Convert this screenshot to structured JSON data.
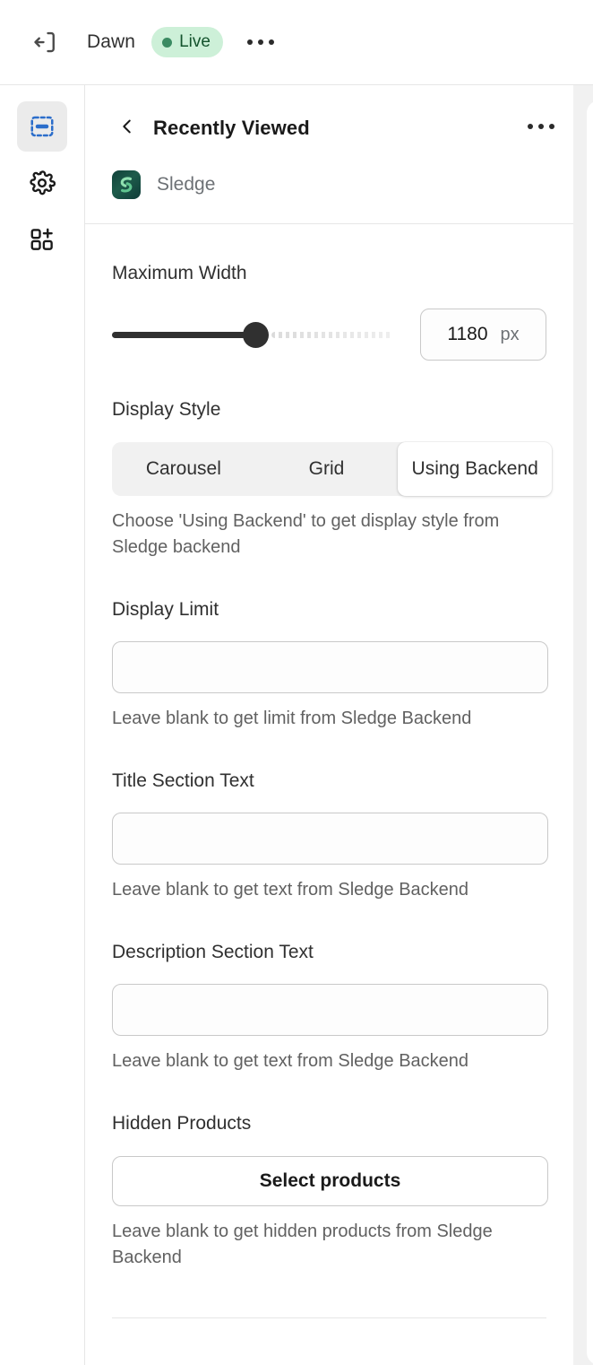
{
  "topbar": {
    "exit_icon": "exit-icon",
    "shop_name": "Dawn",
    "status_label": "Live",
    "status_color": "#cdf0d8",
    "status_dot_color": "#3b8b62",
    "more_icon": "ellipsis-icon"
  },
  "rail": {
    "items": [
      {
        "icon": "sections-icon",
        "name": "sections",
        "active": true,
        "color": "#2c6ecb"
      },
      {
        "icon": "gear-icon",
        "name": "theme-settings",
        "active": false,
        "color": "#1a1a1a"
      },
      {
        "icon": "app-blocks-add-icon",
        "name": "apps",
        "active": false,
        "color": "#1a1a1a"
      }
    ]
  },
  "panel": {
    "back_icon": "chevron-left-icon",
    "title": "Recently Viewed",
    "more_icon": "ellipsis-icon",
    "app": {
      "icon": "sledge-app-icon",
      "name": "Sledge"
    }
  },
  "fields": {
    "maximum_width": {
      "label": "Maximum Width",
      "value": "1180",
      "unit": "px",
      "slider_percent": 52
    },
    "display_style": {
      "label": "Display Style",
      "options": [
        "Carousel",
        "Grid",
        "Using Backend"
      ],
      "selected": "Using Backend",
      "help": "Choose 'Using Backend' to get display style from Sledge backend"
    },
    "display_limit": {
      "label": "Display Limit",
      "value": "",
      "placeholder": "",
      "help": "Leave blank to get limit from Sledge Backend"
    },
    "title_section_text": {
      "label": "Title Section Text",
      "value": "",
      "placeholder": "",
      "help": "Leave blank to get text from Sledge Backend"
    },
    "description_section_text": {
      "label": "Description Section Text",
      "value": "",
      "placeholder": "",
      "help": "Leave blank to get text from Sledge Backend"
    },
    "hidden_products": {
      "label": "Hidden Products",
      "button_label": "Select products",
      "help": "Leave blank to get hidden products from Sledge Backend"
    }
  }
}
